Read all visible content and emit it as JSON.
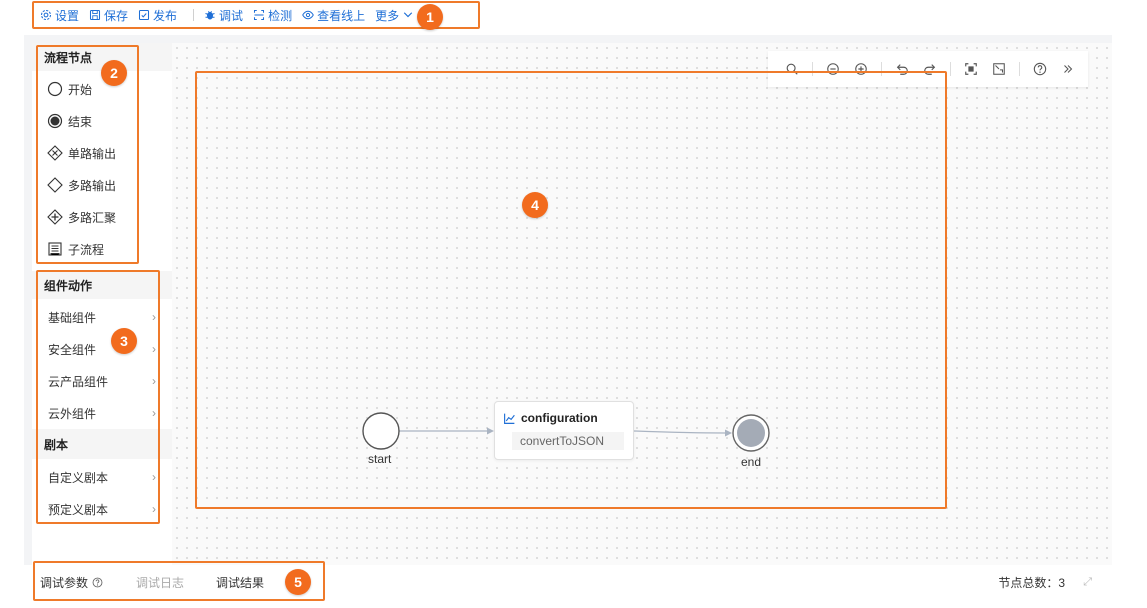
{
  "toolbar": {
    "settings": "设置",
    "save": "保存",
    "publish": "发布",
    "debug": "调试",
    "check": "检测",
    "view_online": "查看线上",
    "more": "更多"
  },
  "sidebar": {
    "flow_nodes_title": "流程节点",
    "flow_nodes": [
      {
        "label": "开始",
        "icon": "circle-empty-icon"
      },
      {
        "label": "结束",
        "icon": "circle-filled-icon"
      },
      {
        "label": "单路输出",
        "icon": "diamond-x-icon"
      },
      {
        "label": "多路输出",
        "icon": "diamond-icon"
      },
      {
        "label": "多路汇聚",
        "icon": "diamond-plus-icon"
      },
      {
        "label": "子流程",
        "icon": "subprocess-icon"
      }
    ],
    "components_title": "组件动作",
    "components": [
      {
        "label": "基础组件"
      },
      {
        "label": "安全组件"
      },
      {
        "label": "云产品组件"
      },
      {
        "label": "云外组件"
      }
    ],
    "playbook_title": "剧本",
    "playbooks": [
      {
        "label": "自定义剧本"
      },
      {
        "label": "预定义剧本"
      }
    ]
  },
  "flow": {
    "start_label": "start",
    "end_label": "end",
    "config_title": "configuration",
    "config_sub": "convertToJSON"
  },
  "bottom": {
    "debug_params": "调试参数",
    "debug_log": "调试日志",
    "debug_result": "调试结果",
    "node_count": "节点总数：3"
  },
  "annotations": [
    "1",
    "2",
    "3",
    "4",
    "5"
  ],
  "colors": {
    "accent": "#1f6fd6",
    "annotation": "#ef7a2a",
    "badge": "#f26b1d"
  }
}
